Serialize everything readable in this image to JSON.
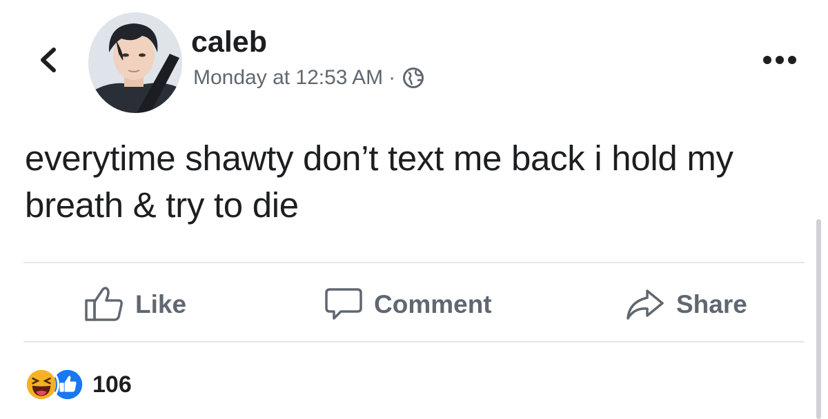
{
  "header": {
    "back_icon": "chevron-left-icon",
    "author": "caleb",
    "timestamp": "Monday at 12:53 AM",
    "separator": "·",
    "privacy_icon": "globe-icon",
    "more_icon": "ellipsis-icon"
  },
  "post": {
    "text": "everytime shawty don’t text me back i hold my breath & try to die"
  },
  "actions": [
    {
      "label": "Like",
      "icon": "thumbs-up-icon"
    },
    {
      "label": "Comment",
      "icon": "comment-bubble-icon"
    },
    {
      "label": "Share",
      "icon": "share-arrow-icon"
    }
  ],
  "reactions": {
    "icons": [
      "haha-reaction-icon",
      "like-reaction-icon"
    ],
    "count": "106"
  },
  "colors": {
    "text": "#1c1e21",
    "secondary_text": "#606770",
    "like_blue": "#1877f2",
    "haha_yellow": "#f7b125",
    "divider": "#e5e6e9"
  }
}
